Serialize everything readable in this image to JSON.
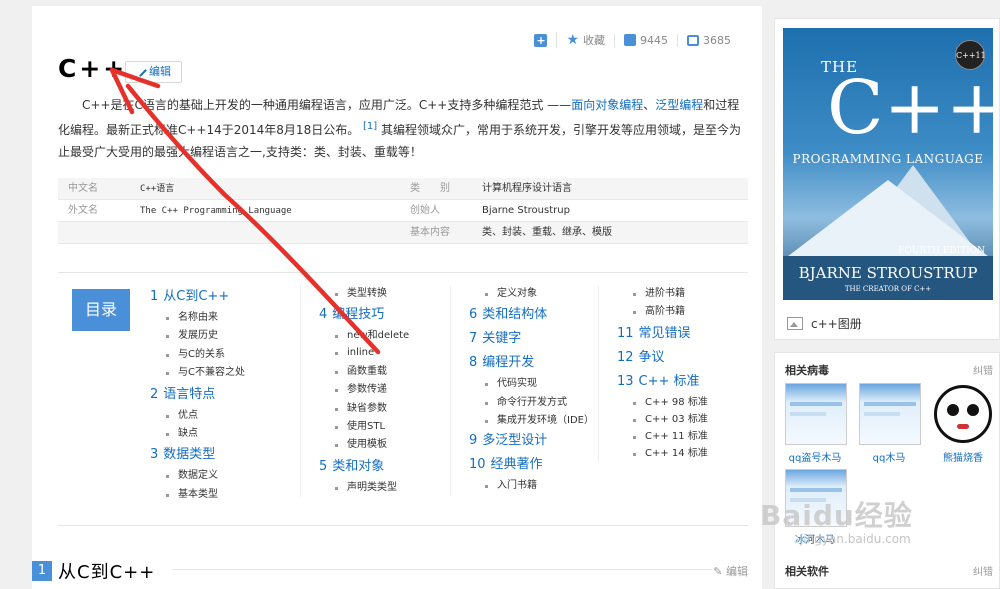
{
  "toolbar": {
    "collect_label": "收藏",
    "like_count": "9445",
    "share_count": "3685"
  },
  "title": "C++",
  "edit_label": "编辑",
  "summary": {
    "part1": "C++是在C语言的基础上开发的一种通用编程语言，应用广泛。C++支持多种编程范式 ——",
    "link1": "面向对象编程",
    "sep": "、",
    "link2": "泛型编程",
    "part2": "和过程化编程。最新正式标准C++14于2014年8月18日公布。",
    "ref": "[1]",
    "part3": "其编程领域众广，常用于系统开发，引擎开发等应用领域，是至今为止最受广大受用的最强大编程语言之一,支持类：类、封装、重载等！"
  },
  "infobox": [
    {
      "k1": "中文名",
      "v1": "C++语言",
      "k2": "类　　别",
      "v2": "计算机程序设计语言"
    },
    {
      "k1": "外文名",
      "v1": "The C++ Programming Language",
      "k2": "创始人",
      "v2": "Bjarne Stroustrup"
    },
    {
      "k1": "",
      "v1": "",
      "k2": "基本内容",
      "v2": "类、封装、重载、继承、模版"
    }
  ],
  "toc": {
    "label": "目录",
    "col1": [
      {
        "num": "1",
        "title": "从C到C++",
        "subs": [
          "名称由来",
          "发展历史",
          "与C的关系",
          "与C不兼容之处"
        ]
      },
      {
        "num": "2",
        "title": "语言特点",
        "subs": [
          "优点",
          "缺点"
        ]
      },
      {
        "num": "3",
        "title": "数据类型",
        "subs": [
          "数据定义",
          "基本类型"
        ]
      }
    ],
    "col2_lead": [
      "类型转换"
    ],
    "col2": [
      {
        "num": "4",
        "title": "编程技巧",
        "subs": [
          "new和delete",
          "inline",
          "函数重载",
          "参数传递",
          "缺省参数",
          "使用STL",
          "使用模板"
        ]
      },
      {
        "num": "5",
        "title": "类和对象",
        "subs": [
          "声明类类型"
        ]
      }
    ],
    "col3_lead": [
      "定义对象"
    ],
    "col3": [
      {
        "num": "6",
        "title": "类和结构体",
        "subs": []
      },
      {
        "num": "7",
        "title": "关键字",
        "subs": []
      },
      {
        "num": "8",
        "title": "编程开发",
        "subs": [
          "代码实现",
          "命令行开发方式",
          "集成开发环境（IDE）"
        ]
      },
      {
        "num": "9",
        "title": "多泛型设计",
        "subs": []
      },
      {
        "num": "10",
        "title": "经典著作",
        "subs": [
          "入门书籍"
        ]
      }
    ],
    "col4_lead": [
      "进阶书籍",
      "高阶书籍"
    ],
    "col4": [
      {
        "num": "11",
        "title": "常见错误",
        "subs": []
      },
      {
        "num": "12",
        "title": "争议",
        "subs": []
      },
      {
        "num": "13",
        "title": "C++ 标准",
        "subs": [
          "C++ 98 标准",
          "C++ 03 标准",
          "C++ 11 标准",
          "C++ 14 标准"
        ]
      }
    ]
  },
  "section": {
    "num": "1",
    "title": "从C到C++",
    "edit": "编辑"
  },
  "cover": {
    "the": "THE",
    "cpp": "C++",
    "subtitle": "PROGRAMMING LANGUAGE",
    "edition": "FOURTH EDITION",
    "author": "BJARNE STROUSTRUP",
    "creator": "THE CREATOR OF C++",
    "badge": "C++11",
    "caption": "c++图册"
  },
  "related": {
    "head": "相关病毒",
    "correct": "纠错",
    "items": [
      "qq盗号木马",
      "qq木马",
      "熊猫烧香",
      "冰河木马"
    ],
    "head2": "相关软件",
    "correct2": "纠错"
  },
  "watermark": {
    "logo": "Baidu经验",
    "url": "jingyan.baidu.com"
  },
  "colors": {
    "accent": "#4a90d9",
    "link": "#136ec2",
    "annotation": "#e8302a"
  }
}
